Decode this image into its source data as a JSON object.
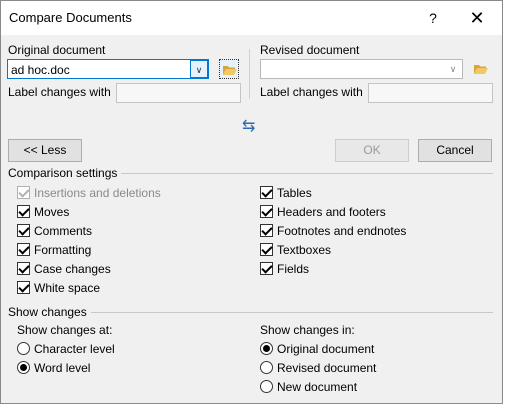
{
  "window": {
    "title": "Compare Documents",
    "help_glyph": "?",
    "close_glyph": "✕"
  },
  "original": {
    "label": "Original document",
    "value": "ad hoc.doc",
    "label_changes": "Label changes with",
    "label_changes_value": ""
  },
  "revised": {
    "label": "Revised document",
    "value": "",
    "label_changes": "Label changes with",
    "label_changes_value": ""
  },
  "swap_glyph": "⇆",
  "buttons": {
    "less": "<< Less",
    "ok": "OK",
    "cancel": "Cancel"
  },
  "comparison_settings": {
    "heading": "Comparison settings",
    "left": [
      {
        "label": "Insertions and deletions",
        "checked": true,
        "disabled": true
      },
      {
        "label": "Moves",
        "checked": true
      },
      {
        "label": "Comments",
        "checked": true
      },
      {
        "label": "Formatting",
        "checked": true
      },
      {
        "label": "Case changes",
        "checked": true
      },
      {
        "label": "White space",
        "checked": true
      }
    ],
    "right": [
      {
        "label": "Tables",
        "checked": true
      },
      {
        "label": "Headers and footers",
        "checked": true
      },
      {
        "label": "Footnotes and endnotes",
        "checked": true
      },
      {
        "label": "Textboxes",
        "checked": true
      },
      {
        "label": "Fields",
        "checked": true
      }
    ]
  },
  "show_changes": {
    "heading": "Show changes",
    "at_label": "Show changes at:",
    "at_options": [
      {
        "label": "Character level",
        "selected": false
      },
      {
        "label": "Word level",
        "selected": true
      }
    ],
    "in_label": "Show changes in:",
    "in_options": [
      {
        "label": "Original document",
        "selected": true
      },
      {
        "label": "Revised document",
        "selected": false
      },
      {
        "label": "New document",
        "selected": false
      }
    ]
  },
  "icons": {
    "folder": "folder-open-icon",
    "dropdown": "chevron-down-icon"
  },
  "colors": {
    "accent": "#0078d7",
    "folder": "#e8b84a"
  }
}
